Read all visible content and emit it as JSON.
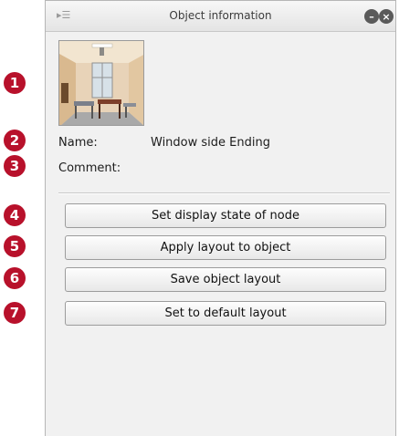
{
  "markers": [
    "1",
    "2",
    "3",
    "4",
    "5",
    "6",
    "7"
  ],
  "titlebar": {
    "title": "Object information",
    "menu_icon": "panel-menu-icon",
    "minimize_icon": "minimize-icon",
    "close_icon": "close-icon"
  },
  "object": {
    "thumbnail": "classroom-window-scene",
    "name_label": "Name:",
    "name_value": "Window side Ending",
    "comment_label": "Comment:",
    "comment_value": ""
  },
  "buttons": {
    "set_display_state": "Set display state of node",
    "apply_layout": "Apply layout to object",
    "save_layout": "Save object layout",
    "set_default": "Set to default layout"
  },
  "colors": {
    "marker": "#b8112b",
    "panel_bg": "#f1f1f1"
  }
}
